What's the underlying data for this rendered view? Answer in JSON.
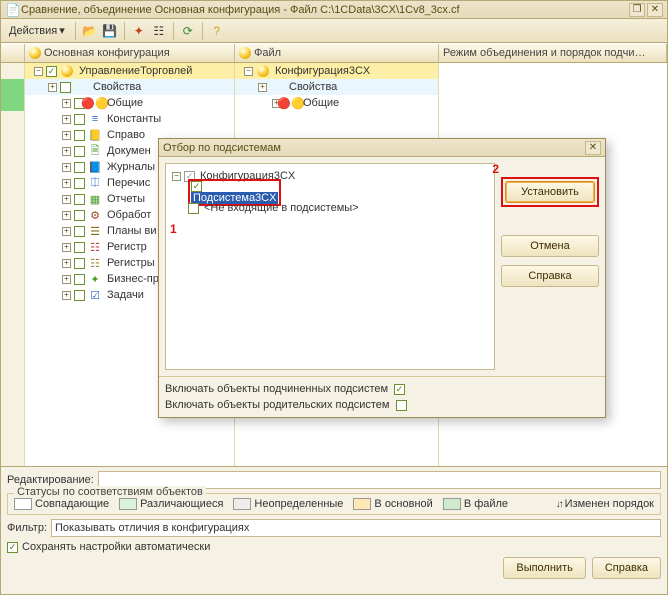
{
  "window": {
    "title": "Сравнение, объединение Основная конфигурация - Файл C:\\1CData\\3CX\\1Cv8_3cx.cf"
  },
  "menubar": {
    "actions": "Действия"
  },
  "columns": {
    "main_config": "Основная конфигурация",
    "file": "Файл",
    "mode": "Режим объединения и порядок подчи…"
  },
  "left_tree": [
    {
      "l": 0,
      "check": true,
      "icon": "ball",
      "label": "УправлениеТорговлей",
      "sel": true
    },
    {
      "l": 1,
      "check": false,
      "icon": "",
      "label": "Свойства",
      "alt": true
    },
    {
      "l": 2,
      "check": false,
      "icon": "balls",
      "label": "Общие"
    },
    {
      "l": 2,
      "check": false,
      "icon": "const",
      "label": "Константы"
    },
    {
      "l": 2,
      "check": false,
      "icon": "book",
      "label": "Справо"
    },
    {
      "l": 2,
      "check": false,
      "icon": "doc",
      "label": "Докумен"
    },
    {
      "l": 2,
      "check": false,
      "icon": "journal",
      "label": "Журналы"
    },
    {
      "l": 2,
      "check": false,
      "icon": "enum",
      "label": "Перечис"
    },
    {
      "l": 2,
      "check": false,
      "icon": "report",
      "label": "Отчеты"
    },
    {
      "l": 2,
      "check": false,
      "icon": "proc",
      "label": "Обработ"
    },
    {
      "l": 2,
      "check": false,
      "icon": "plan",
      "label": "Планы ви"
    },
    {
      "l": 2,
      "check": false,
      "icon": "reg",
      "label": "Регистр"
    },
    {
      "l": 2,
      "check": false,
      "icon": "reg2",
      "label": "Регистры"
    },
    {
      "l": 2,
      "check": false,
      "icon": "bp",
      "label": "Бизнес-пр"
    },
    {
      "l": 2,
      "check": false,
      "icon": "task",
      "label": "Задачи"
    }
  ],
  "mid_tree": [
    {
      "l": 0,
      "icon": "ball",
      "label": "Конфигурация3CX",
      "sel": true
    },
    {
      "l": 1,
      "icon": "",
      "label": "Свойства",
      "alt": true
    },
    {
      "l": 2,
      "icon": "balls",
      "label": "Общие"
    }
  ],
  "modal": {
    "title": "Отбор по подсистемам",
    "tree": {
      "root": "Конфигурация3CX",
      "child": "Подсистема3CX",
      "excluded": "<Не входящие в подсистемы>"
    },
    "marker1": "1",
    "marker2": "2",
    "buttons": {
      "set": "Установить",
      "cancel": "Отмена",
      "help": "Справка"
    },
    "include_child": "Включать объекты подчиненных подсистем",
    "include_parent": "Включать объекты родительских подсистем",
    "include_child_checked": true,
    "include_parent_checked": false
  },
  "bottom": {
    "editing_label": "Редактирование:",
    "status_legend": "Статусы по соответствиям объектов",
    "statuses": {
      "match": "Совпадающие",
      "diff": "Различающиеся",
      "undef": "Неопределенные",
      "in_main": "В основной",
      "in_file": "В файле",
      "order": "Изменен порядок"
    },
    "filter_label": "Фильтр:",
    "filter_value": "Показывать отличия в конфигурациях",
    "autosave": "Сохранять настройки автоматически",
    "autosave_checked": true,
    "run": "Выполнить",
    "help": "Справка"
  }
}
